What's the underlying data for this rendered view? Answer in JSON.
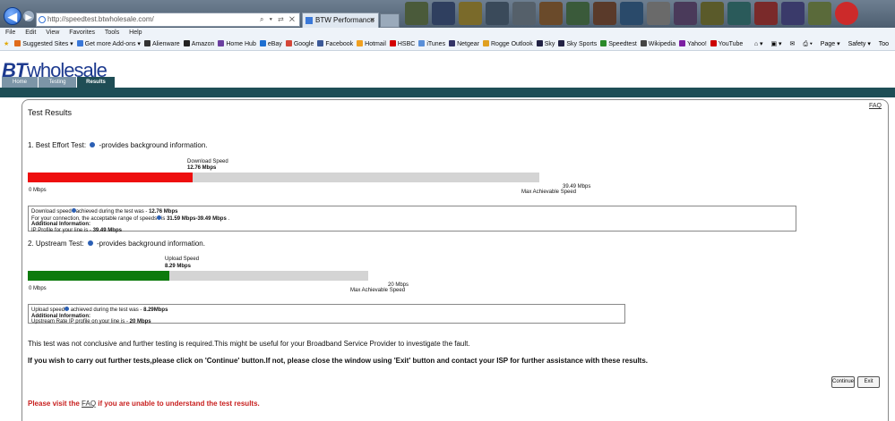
{
  "browser": {
    "address": "http://speedtest.btwholesale.com/",
    "tab_title": "BTW Performance Test",
    "menu": [
      "File",
      "Edit",
      "View",
      "Favorites",
      "Tools",
      "Help"
    ],
    "favorites": [
      {
        "label": "Suggested Sites ▾",
        "icon": "suggested-sites-icon",
        "color": "#e06b1a"
      },
      {
        "label": "Get more Add-ons ▾",
        "icon": "add-ons-icon",
        "color": "#3a78d8"
      },
      {
        "label": "Alienware",
        "icon": "alienware-icon",
        "color": "#333333"
      },
      {
        "label": "Amazon",
        "icon": "amazon-icon",
        "color": "#222222"
      },
      {
        "label": "Home Hub",
        "icon": "home-hub-icon",
        "color": "#6b3fa0"
      },
      {
        "label": "eBay",
        "icon": "ebay-icon",
        "color": "#1d6fd1"
      },
      {
        "label": "Google",
        "icon": "google-icon",
        "color": "#d44638"
      },
      {
        "label": "Facebook",
        "icon": "facebook-icon",
        "color": "#3b5998"
      },
      {
        "label": "Hotmail",
        "icon": "hotmail-icon",
        "color": "#f0a020"
      },
      {
        "label": "HSBC",
        "icon": "hsbc-icon",
        "color": "#d40000"
      },
      {
        "label": "iTunes",
        "icon": "itunes-icon",
        "color": "#5a8fd8"
      },
      {
        "label": "Netgear",
        "icon": "netgear-icon",
        "color": "#333366"
      },
      {
        "label": "Rogge Outlook",
        "icon": "outlook-icon",
        "color": "#e0a020"
      },
      {
        "label": "Sky",
        "icon": "sky-icon",
        "color": "#222244"
      },
      {
        "label": "Sky Sports",
        "icon": "sky-sports-icon",
        "color": "#222244"
      },
      {
        "label": "Speedtest",
        "icon": "speedtest-icon",
        "color": "#2a8a2a"
      },
      {
        "label": "Wikipedia",
        "icon": "wikipedia-icon",
        "color": "#444444"
      },
      {
        "label": "Yahoo!",
        "icon": "yahoo-icon",
        "color": "#7b1fa2"
      },
      {
        "label": "YouTube",
        "icon": "youtube-icon",
        "color": "#cc0000"
      }
    ],
    "right_tools": [
      "Page ▾",
      "Safety ▾",
      "Too"
    ]
  },
  "site": {
    "logo_bt": "BT",
    "logo_wholesale": "wholesale",
    "tabs": {
      "home": "Home",
      "testing": "Testing",
      "results": "Results"
    }
  },
  "results": {
    "title": "Test Results",
    "faq": "FAQ",
    "best_effort": {
      "heading": "1. Best Effort Test:",
      "suffix": "-provides background information.",
      "speed_label": "Download Speed",
      "speed_value": "12.76 Mbps",
      "min_label": "0 Mbps",
      "max_value": "39.49 Mbps",
      "max_label": "Max Achievable Speed",
      "fill_fraction": 0.323,
      "fill_color": "#ee0e0e",
      "info": {
        "line1_prefix": "Download speed",
        "line1_mid": "achieved during the test was - ",
        "line1_value": "12.76 Mbps",
        "line2_prefix": "For your connection, the acceptable range of speeds",
        "line2_mid": "is ",
        "line2_value": "31.59 Mbps-39.49 Mbps",
        "line2_suffix": " .",
        "additional": "Additional Information:",
        "line3_prefix": "IP Profile for your line is - ",
        "line3_value": "39.49 Mbps"
      }
    },
    "upstream": {
      "heading": "2. Upstream Test:",
      "suffix": "-provides background information.",
      "speed_label": "Upload Speed",
      "speed_value": "8.29 Mbps",
      "min_label": "0 Mbps",
      "max_value": "20 Mbps",
      "max_label": "Max Achievable Speed",
      "fill_fraction": 0.4145,
      "fill_color": "#0d7a0d",
      "info": {
        "line1_prefix": "Upload speed",
        "line1_mid": " achieved during the test was - ",
        "line1_value": "8.29Mbps",
        "additional": "Additional Information:",
        "line2_prefix": "Upstream Rate IP profile on your line is - ",
        "line2_value": "20 Mbps"
      }
    },
    "conclusion": "This test was not conclusive and further testing is required.This might be useful for your Broadband Service Provider to investigate the fault.",
    "instruction": "If you wish to carry out further tests,please click on 'Continue' button.If not, please close the window using 'Exit' button and contact your ISP for further assistance with these results.",
    "continue_label": "Continue",
    "exit_label": "Exit",
    "visit_prefix": "Please visit the ",
    "visit_link": "FAQ",
    "visit_suffix": " if you are unable to understand the test results."
  }
}
